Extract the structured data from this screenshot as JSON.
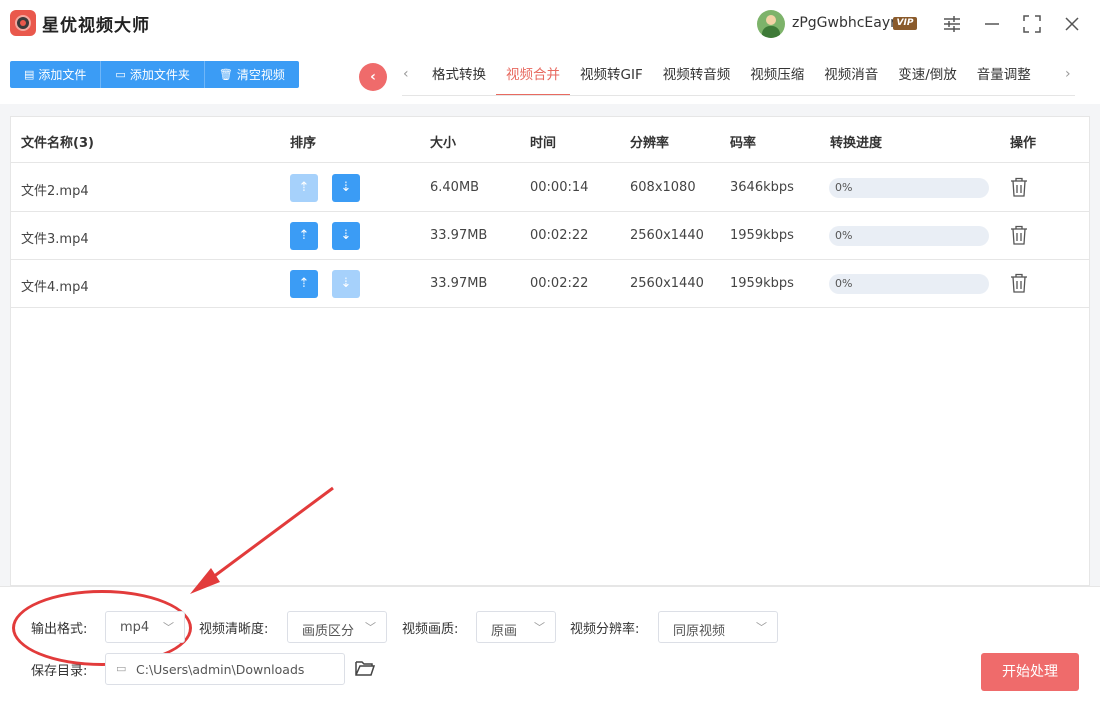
{
  "app": {
    "title": "星优视频大师",
    "username": "zPgGwbhcEayr",
    "vip_label": "VIP"
  },
  "toolbar": {
    "add_file": "添加文件",
    "add_folder": "添加文件夹",
    "clear_videos": "清空视频"
  },
  "tabs": [
    {
      "label": "格式转换",
      "active": false
    },
    {
      "label": "视频合并",
      "active": true
    },
    {
      "label": "视频转GIF",
      "active": false
    },
    {
      "label": "视频转音频",
      "active": false
    },
    {
      "label": "视频压缩",
      "active": false
    },
    {
      "label": "视频消音",
      "active": false
    },
    {
      "label": "变速/倒放",
      "active": false
    },
    {
      "label": "音量调整",
      "active": false
    }
  ],
  "table": {
    "headers": {
      "name": "文件名称(3)",
      "sort": "排序",
      "size": "大小",
      "time": "时间",
      "resolution": "分辨率",
      "bitrate": "码率",
      "progress": "转换进度",
      "actions": "操作"
    },
    "rows": [
      {
        "name": "文件2.mp4",
        "size": "6.40MB",
        "time": "00:00:14",
        "resolution": "608x1080",
        "bitrate": "3646kbps",
        "progress": "0%",
        "progress_value": 0,
        "up_enabled": false,
        "down_enabled": true
      },
      {
        "name": "文件3.mp4",
        "size": "33.97MB",
        "time": "00:02:22",
        "resolution": "2560x1440",
        "bitrate": "1959kbps",
        "progress": "0%",
        "progress_value": 0,
        "up_enabled": true,
        "down_enabled": true
      },
      {
        "name": "文件4.mp4",
        "size": "33.97MB",
        "time": "00:02:22",
        "resolution": "2560x1440",
        "bitrate": "1959kbps",
        "progress": "0%",
        "progress_value": 0,
        "up_enabled": true,
        "down_enabled": false
      }
    ]
  },
  "settings": {
    "output_format_label": "输出格式:",
    "output_format_value": "mp4",
    "clarity_label": "视频清晰度:",
    "clarity_value": "画质区分",
    "quality_label": "视频画质:",
    "quality_value": "原画",
    "resolution_label": "视频分辨率:",
    "resolution_value": "同原视频",
    "save_dir_label": "保存目录:",
    "save_dir_value": "C:\\Users\\admin\\Downloads",
    "start_button": "开始处理"
  },
  "colors": {
    "accent_blue": "#3b9cf5",
    "accent_red": "#ef6b6b",
    "annotation_red": "#e23b3b"
  }
}
